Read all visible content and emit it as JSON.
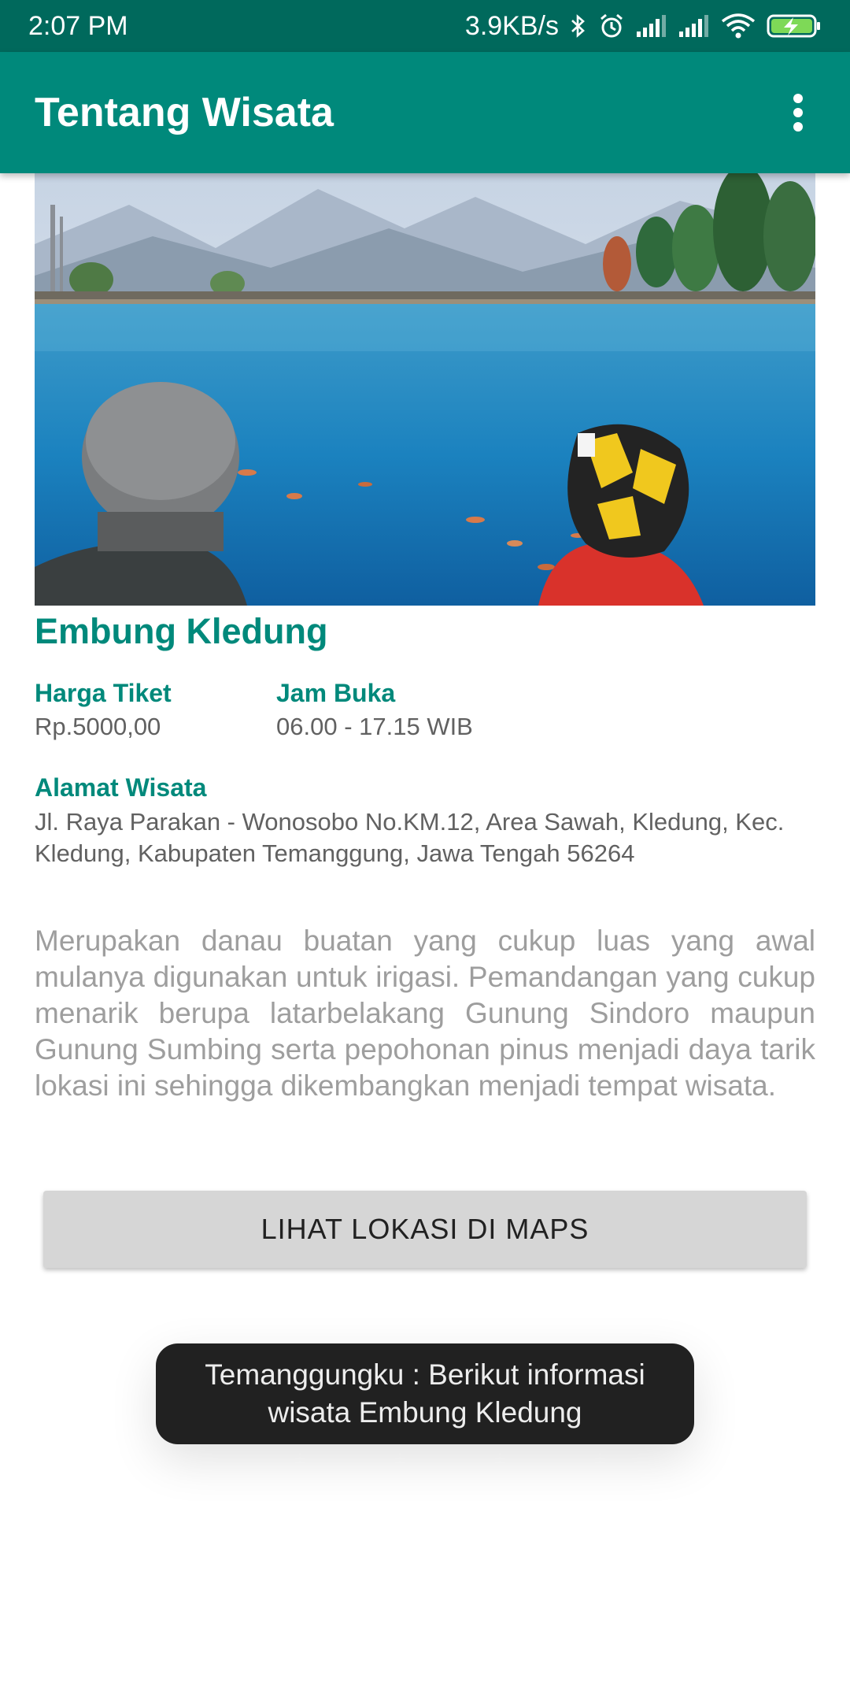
{
  "status_bar": {
    "time": "2:07 PM",
    "net_speed": "3.9KB/s",
    "icons": [
      "bluetooth-icon",
      "alarm-icon",
      "signal-icon",
      "signal-icon",
      "wifi-icon",
      "battery-charging-icon"
    ]
  },
  "app_bar": {
    "title": "Tentang Wisata",
    "menu_icon": "more-vert-icon"
  },
  "place": {
    "name": "Embung Kledung",
    "ticket_label": "Harga Tiket",
    "ticket_value": "Rp.5000,00",
    "hours_label": "Jam Buka",
    "hours_value": "06.00 - 17.15 WIB",
    "address_label": "Alamat Wisata",
    "address_value": "Jl. Raya Parakan - Wonosobo No.KM.12, Area Sawah, Kledung, Kec. Kledung, Kabupaten Temanggung, Jawa Tengah 56264",
    "description": "Merupakan danau buatan yang cukup luas yang awal mulanya digunakan untuk irigasi. Pemandangan yang cukup menarik berupa latarbelakang Gunung Sindoro maupun Gunung Sumbing serta pepohonan pinus menjadi daya tarik lokasi ini sehingga dikembangkan menjadi tempat wisata."
  },
  "maps_button": {
    "label": "LIHAT LOKASI DI MAPS"
  },
  "toast": {
    "message": "Temanggungku : Berikut informasi wisata Embung Kledung"
  },
  "colors": {
    "status_bar": "#00695c",
    "primary": "#00897b",
    "button_bg": "#d6d6d6",
    "toast_bg": "#212121"
  }
}
